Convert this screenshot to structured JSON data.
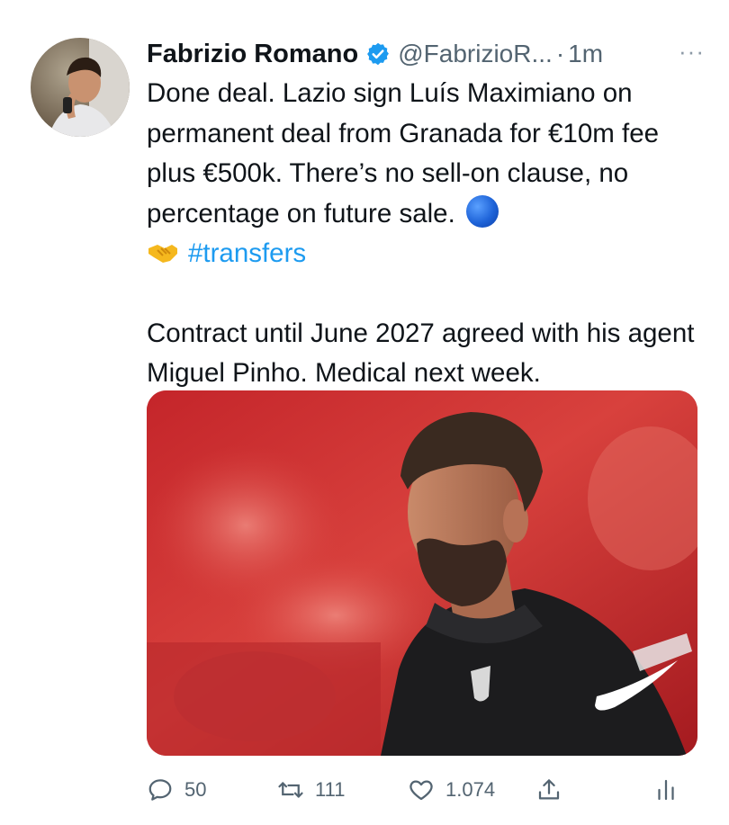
{
  "author": {
    "name": "Fabrizio Romano",
    "handle": "@FabrizioR...",
    "separator": "·",
    "time": "1m",
    "verified": true,
    "more_icon": "more-dots-icon"
  },
  "tweet": {
    "paragraph1": "Done deal. Lazio sign Luís Maximiano on permanent deal from Granada for €10m fee plus €500k. There’s no sell-on clause, no percentage on future sale.",
    "emoji_circle": "blue-circle-emoji",
    "emoji_handshake": "handshake-emoji",
    "hashtag": "#transfers",
    "paragraph2": "Contract until June 2027 agreed with his agent Miguel Pinho. Medical next week."
  },
  "media": {
    "description_icon": "player-photo"
  },
  "actions": {
    "replies": "50",
    "retweets": "111",
    "likes": "1.074"
  },
  "colors": {
    "accent": "#1d9bf0",
    "text": "#0f1419",
    "muted": "#536471"
  }
}
